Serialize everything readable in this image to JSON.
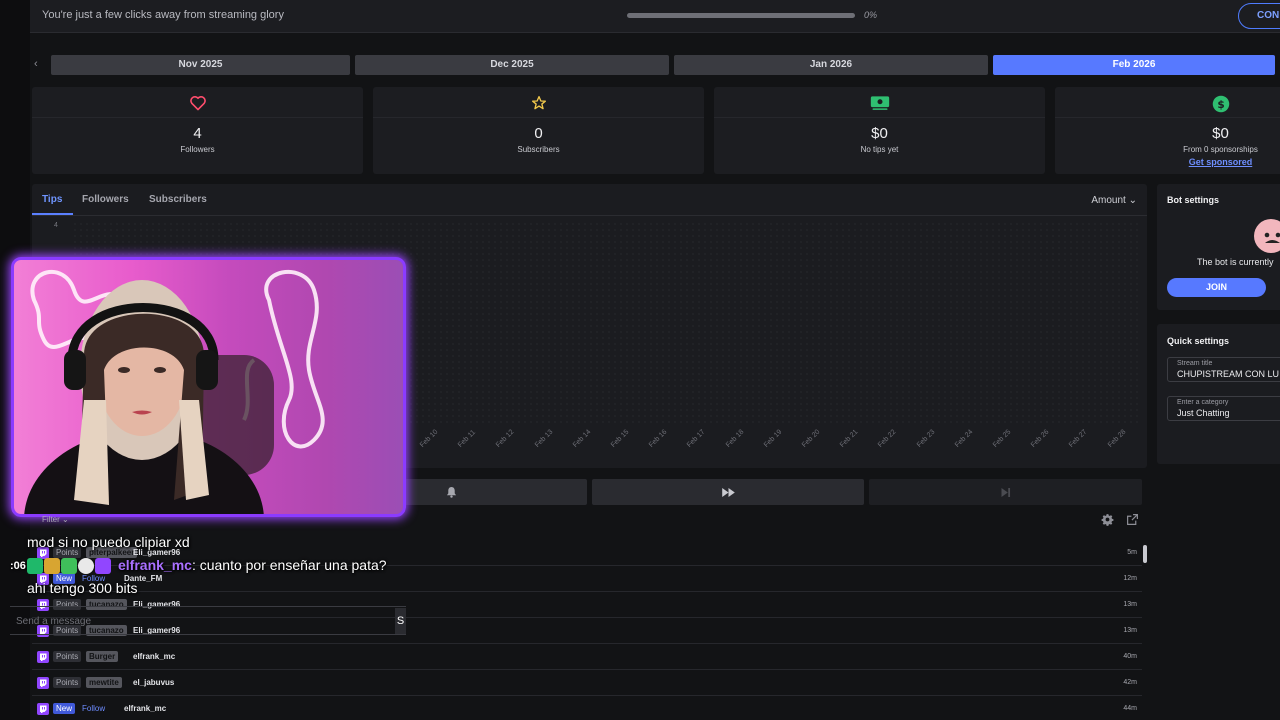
{
  "banner": {
    "text": "You're just a few clicks away from streaming glory",
    "progress": 0,
    "progress_label": "0%",
    "button_label": "CON"
  },
  "months": [
    "Nov 2025",
    "Dec 2025",
    "Jan 2026",
    "Feb 2026"
  ],
  "active_month": "Feb 2026",
  "stats": [
    {
      "icon": "heart-icon",
      "value": "4",
      "label": "Followers"
    },
    {
      "icon": "star-icon",
      "value": "0",
      "label": "Subscribers"
    },
    {
      "icon": "cash-icon",
      "value": "$0",
      "label": "No tips yet"
    },
    {
      "icon": "dollar-coin-icon",
      "value": "$0",
      "label": "From 0 sponsorships",
      "link": "Get sponsored"
    }
  ],
  "chart_tabs": [
    "Tips",
    "Followers",
    "Subscribers"
  ],
  "amount_label": "Amount",
  "chart_data": {
    "type": "line",
    "y_tick_visible": "4",
    "x_tick_labels": [
      "Feb 10",
      "Feb 11",
      "Feb 12",
      "Feb 13",
      "Feb 14",
      "Feb 15",
      "Feb 16",
      "Feb 17",
      "Feb 18",
      "Feb 19",
      "Feb 20",
      "Feb 21",
      "Feb 22",
      "Feb 23",
      "Feb 24",
      "Feb 25",
      "Feb 26",
      "Feb 27",
      "Feb 28"
    ],
    "grid": true
  },
  "bot": {
    "title": "Bot settings",
    "status": "The bot is currently",
    "join_label": "JOIN"
  },
  "quick": {
    "title": "Quick settings",
    "stream_title_label": "Stream title",
    "stream_title_value": "CHUPISTREAM CON LU",
    "category_label": "Enter a category",
    "category_value": "Just Chatting"
  },
  "feed": [
    {
      "badge": "Points",
      "tag": "piterpalkeer",
      "user": "Eli_gamer96",
      "time": "5m"
    },
    {
      "badge": "New",
      "kind": "Follow",
      "user": "Dante_FM",
      "time": "12m"
    },
    {
      "badge": "Points",
      "tag": "tucanazo",
      "user": "Eli_gamer96",
      "time": "13m"
    },
    {
      "badge": "Points",
      "tag": "tucanazo",
      "user": "Eli_gamer96",
      "time": "13m"
    },
    {
      "badge": "Points",
      "tag": "Burger",
      "user": "elfrank_mc",
      "time": "40m"
    },
    {
      "badge": "Points",
      "tag": "mewtite",
      "user": "el_jabuvus",
      "time": "42m"
    },
    {
      "badge": "New",
      "kind": "Follow",
      "user": "elfrank_mc",
      "time": "44m"
    }
  ],
  "chat": {
    "filter_label": "Filter",
    "line1": "mod si no puedo clipiar xd",
    "timestamp": ":06",
    "line2_user": "elfrank_mc",
    "line2_text": ": cuanto por enseñar una pata?",
    "line3": "ahi tengo 300 bits",
    "input_placeholder": "Send a message",
    "send_label": "S"
  },
  "colors": {
    "accent": "#5779ff",
    "twitch_purple": "#9146ff",
    "background": "#121315",
    "card": "#1c1d21"
  }
}
